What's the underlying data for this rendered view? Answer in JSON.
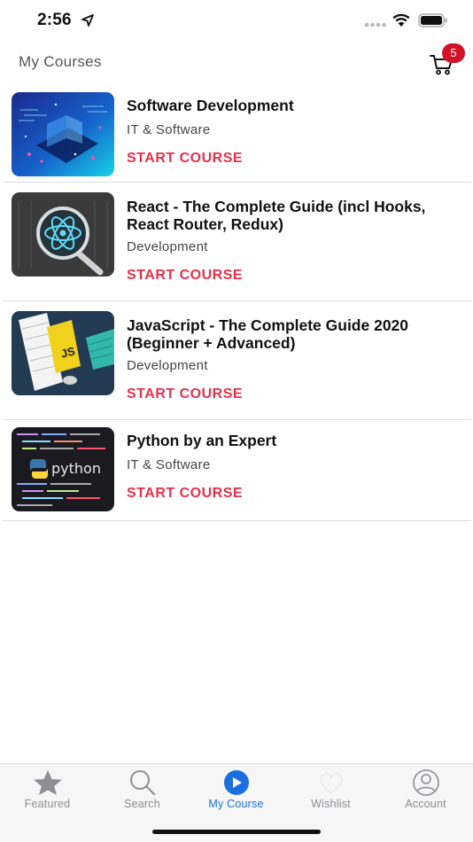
{
  "status_bar": {
    "time": "2:56"
  },
  "header": {
    "title": "My Courses",
    "cart_count": "5"
  },
  "courses": [
    {
      "title": "Software Development",
      "category": "IT & Software",
      "action": "START COURSE",
      "thumbnail": "software-development"
    },
    {
      "title": "React - The Complete Guide (incl Hooks, React Router, Redux)",
      "category": "Development",
      "action": "START COURSE",
      "thumbnail": "react-atom"
    },
    {
      "title": "JavaScript - The Complete Guide 2020 (Beginner + Advanced)",
      "category": "Development",
      "action": "START COURSE",
      "thumbnail": "js-notebook",
      "thumb_text": "JS"
    },
    {
      "title": "Python by an Expert",
      "category": "IT & Software",
      "action": "START COURSE",
      "thumbnail": "python-code",
      "thumb_text": "python"
    }
  ],
  "tab_bar": {
    "items": [
      {
        "label": "Featured",
        "icon": "star-icon"
      },
      {
        "label": "Search",
        "icon": "search-icon"
      },
      {
        "label": "My Course",
        "icon": "play-circle-icon",
        "active": true
      },
      {
        "label": "Wishlist",
        "icon": "heart-icon"
      },
      {
        "label": "Account",
        "icon": "person-circle-icon"
      }
    ]
  },
  "colors": {
    "accent_red": "#e8304a",
    "active_blue": "#1a6fe0",
    "badge_red": "#d01328"
  }
}
